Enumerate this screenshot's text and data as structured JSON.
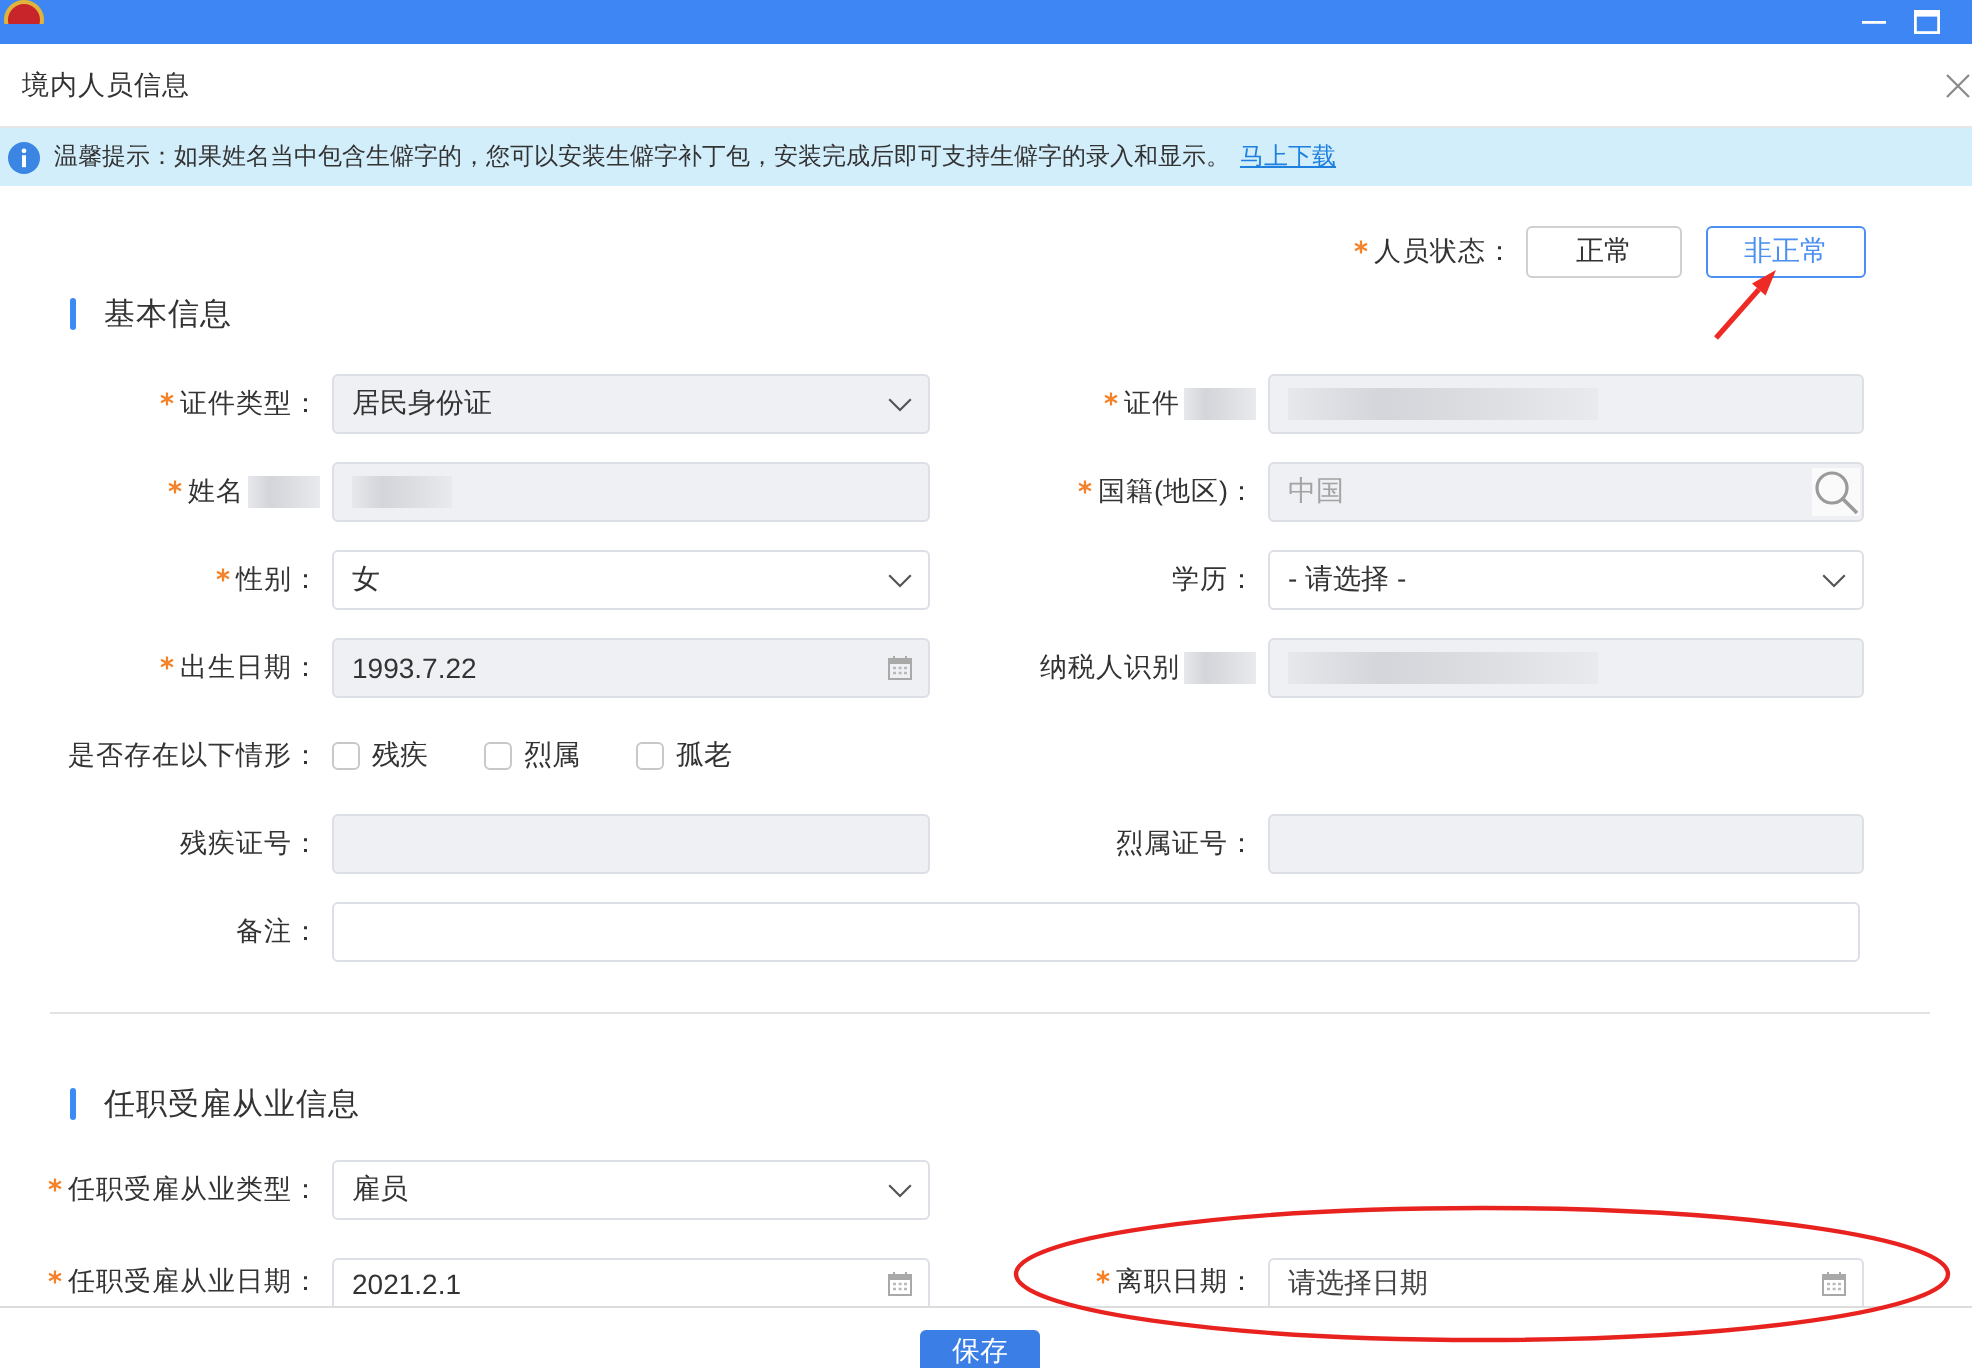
{
  "dialog": {
    "title": "境内人员信息"
  },
  "notice": {
    "text": "温馨提示：如果姓名当中包含生僻字的，您可以安装生僻字补丁包，安装完成后即可支持生僻字的录入和显示。",
    "link": "马上下载"
  },
  "status": {
    "label": "人员状态：",
    "required": true,
    "options": [
      {
        "label": "正常",
        "selected": false,
        "arrow_marked": false
      },
      {
        "label": "非正常",
        "selected": true,
        "arrow_marked": true
      }
    ]
  },
  "sections": [
    {
      "title": "基本信息",
      "rows": [
        [
          {
            "label": "证件类型：",
            "required": true,
            "kind": "select",
            "value": "居民身份证",
            "disabled": true
          },
          {
            "label": "证件",
            "required": true,
            "label_redacted": true,
            "kind": "text",
            "redacted": true,
            "disabled": true
          }
        ],
        [
          {
            "label": "姓名",
            "required": true,
            "label_redacted": true,
            "kind": "text",
            "redacted": true,
            "disabled": true
          },
          {
            "label": "国籍(地区)：",
            "required": true,
            "kind": "search",
            "placeholder": "中国",
            "disabled": true
          }
        ],
        [
          {
            "label": "性别：",
            "required": true,
            "kind": "select",
            "value": "女",
            "disabled": false
          },
          {
            "label": "学历：",
            "required": false,
            "kind": "select",
            "value": "- 请选择 -",
            "disabled": false
          }
        ],
        [
          {
            "label": "出生日期：",
            "required": true,
            "kind": "date",
            "value": "1993.7.22",
            "disabled": true
          },
          {
            "label": "纳税人识别",
            "required": false,
            "label_redacted": true,
            "kind": "text",
            "redacted": true,
            "disabled": true
          }
        ],
        [
          {
            "label": "是否存在以下情形：",
            "required": false,
            "kind": "checks",
            "options": [
              {
                "label": "残疾",
                "checked": false
              },
              {
                "label": "烈属",
                "checked": false
              },
              {
                "label": "孤老",
                "checked": false
              }
            ]
          }
        ],
        [
          {
            "label": "残疾证号：",
            "required": false,
            "kind": "text",
            "disabled": true
          },
          {
            "label": "烈属证号：",
            "required": false,
            "kind": "text",
            "disabled": true
          }
        ],
        [
          {
            "label": "备注：",
            "required": false,
            "kind": "remark",
            "disabled": false
          }
        ]
      ]
    },
    {
      "title": "任职受雇从业信息",
      "rows": [
        [
          {
            "label": "任职受雇从业类型：",
            "required": true,
            "kind": "select",
            "value": "雇员",
            "disabled": false
          }
        ],
        [
          {
            "label": "任职受雇从业日期：",
            "required": true,
            "kind": "date",
            "value": "2021.2.1",
            "disabled": false,
            "circled": false
          },
          {
            "label": "离职日期：",
            "required": true,
            "kind": "date",
            "placeholder": "请选择日期",
            "disabled": false,
            "circled": true
          }
        ]
      ]
    }
  ],
  "footer": {
    "save": "保存"
  }
}
